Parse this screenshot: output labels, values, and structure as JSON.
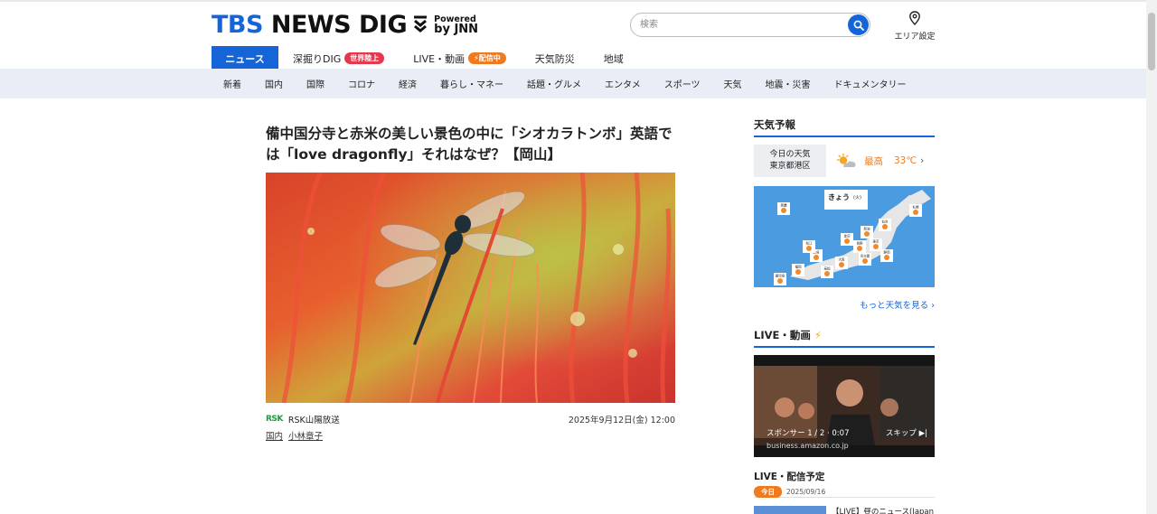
{
  "header": {
    "logo_tbs": "TBS",
    "logo_news": " NEWS DIG",
    "logo_powered": "Powered",
    "logo_by": "by JNN",
    "search_placeholder": "検索",
    "area_label": "エリア設定"
  },
  "main_nav": [
    {
      "label": "ニュース",
      "active": true
    },
    {
      "label": "深掘りDIG",
      "badge": "世界陸上",
      "badge_color": "#e5384f"
    },
    {
      "label": "LIVE・動画",
      "badge": "配信中",
      "badge_color": "#f07a1f"
    },
    {
      "label": "天気防災"
    },
    {
      "label": "地域"
    }
  ],
  "sub_nav": [
    "新着",
    "国内",
    "国際",
    "コロナ",
    "経済",
    "暮らし・マネー",
    "話題・グルメ",
    "エンタメ",
    "スポーツ",
    "天気",
    "地震・災害",
    "ドキュメンタリー"
  ],
  "article": {
    "title": "備中国分寺と赤米の美しい景色の中に「シオカラトンボ」英語では「love dragonfly」それはなぜ？【岡山】",
    "source_logo": "RSK",
    "source": "RSK山陽放送",
    "date": "2025年9月12日(金) 12:00",
    "tags": [
      "国内",
      "小林章子"
    ]
  },
  "sidebar": {
    "weather_heading": "天気予報",
    "weather_where_1": "今日の天気",
    "weather_where_2": "東京都港区",
    "weather_high_label": "最高",
    "weather_high_value": "33℃",
    "map_title": "きょう",
    "map_day": "(火)",
    "map_cities": [
      "札幌",
      "仙台",
      "新潟",
      "東京",
      "金沢",
      "長野",
      "名古屋",
      "大阪",
      "広島",
      "高知",
      "福岡",
      "鹿児島",
      "那覇",
      "静岡",
      "松江"
    ],
    "more_weather": "もっと天気を見る",
    "live_heading": "LIVE・動画",
    "video_sponsor": "スポンサー 1 / 2 · 0:07",
    "video_skip": "スキップ",
    "video_url": "business.amazon.co.jp",
    "schedule_heading": "LIVE・配信予定",
    "schedule_today": "今日",
    "schedule_date": "2025/09/16",
    "schedule_item": "【LIVE】昼のニュース(Japan"
  },
  "colors": {
    "accent": "#1565d8",
    "orange": "#f07a1f",
    "red_badge": "#e5384f",
    "subnav_bg": "#e9edf5"
  }
}
